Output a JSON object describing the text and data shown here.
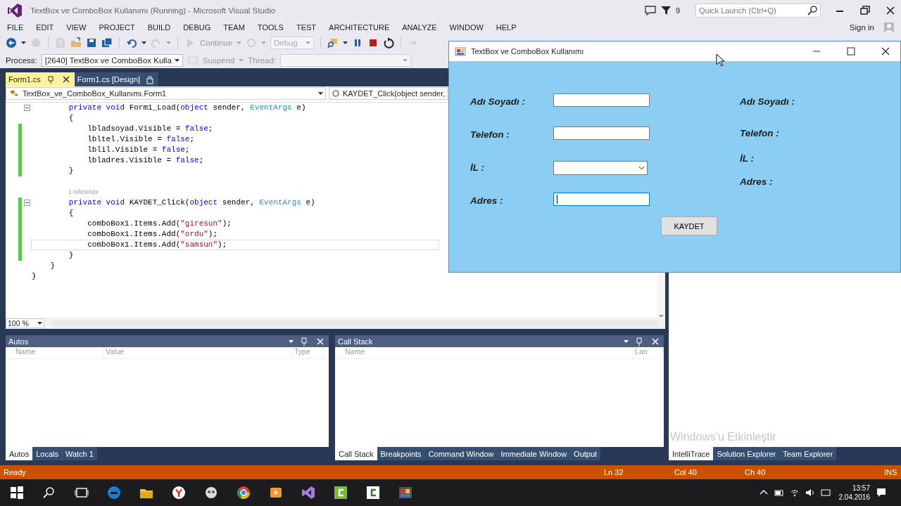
{
  "ide": {
    "title": "TextBox ve ComboBox Kullanımı (Running) - Microsoft Visual Studio",
    "notification_count": "9",
    "quick_launch": {
      "placeholder": "Quick Launch (Ctrl+Q)"
    },
    "menu": [
      "FILE",
      "EDIT",
      "VIEW",
      "PROJECT",
      "BUILD",
      "DEBUG",
      "TEAM",
      "TOOLS",
      "TEST",
      "ARCHITECTURE",
      "ANALYZE",
      "WINDOW",
      "HELP"
    ],
    "sign_in": "Sign in",
    "toolbar": {
      "continue": "Continue",
      "configuration": "Debug"
    },
    "debug_location": {
      "process_label": "Process:",
      "process": "[2640] TextBox ve ComboBox Kulla",
      "suspend": "Suspend",
      "thread_label": "Thread:"
    }
  },
  "editor": {
    "tabs": [
      {
        "label": "Form1.cs",
        "selected": true
      },
      {
        "label": "Form1.cs [Design]",
        "selected": false
      }
    ],
    "type_selector": "TextBox_ve_ComboBox_Kullanımı.Form1",
    "member_selector": "KAYDET_Click(object sender,",
    "lines": [
      {
        "kind": "code",
        "foldable": true,
        "changed": false,
        "current": false,
        "segments": [
          {
            "kind": "kw",
            "text": "        private void"
          },
          {
            "kind": "plain",
            "text": " Form1_Load("
          },
          {
            "kind": "kw",
            "text": "object"
          },
          {
            "kind": "plain",
            "text": " sender, "
          },
          {
            "kind": "type",
            "text": "EventArgs"
          },
          {
            "kind": "plain",
            "text": " e)"
          }
        ]
      },
      {
        "kind": "code",
        "foldable": false,
        "changed": false,
        "current": false,
        "segments": [
          {
            "kind": "plain",
            "text": "        {"
          }
        ]
      },
      {
        "kind": "code",
        "foldable": false,
        "changed": true,
        "current": false,
        "segments": [
          {
            "kind": "plain",
            "text": "            lbladsoyad.Visible = "
          },
          {
            "kind": "kw",
            "text": "false"
          },
          {
            "kind": "plain",
            "text": ";"
          }
        ]
      },
      {
        "kind": "code",
        "foldable": false,
        "changed": true,
        "current": false,
        "segments": [
          {
            "kind": "plain",
            "text": "            lbltel.Visible = "
          },
          {
            "kind": "kw",
            "text": "false"
          },
          {
            "kind": "plain",
            "text": ";"
          }
        ]
      },
      {
        "kind": "code",
        "foldable": false,
        "changed": true,
        "current": false,
        "segments": [
          {
            "kind": "plain",
            "text": "            lblil.Visible = "
          },
          {
            "kind": "kw",
            "text": "false"
          },
          {
            "kind": "plain",
            "text": ";"
          }
        ]
      },
      {
        "kind": "code",
        "foldable": false,
        "changed": true,
        "current": false,
        "segments": [
          {
            "kind": "plain",
            "text": "            lbladres.Visible = "
          },
          {
            "kind": "kw",
            "text": "false"
          },
          {
            "kind": "plain",
            "text": ";"
          }
        ]
      },
      {
        "kind": "code",
        "foldable": false,
        "changed": true,
        "current": false,
        "segments": [
          {
            "kind": "plain",
            "text": "        }"
          }
        ]
      },
      {
        "kind": "blank"
      },
      {
        "kind": "codelens",
        "text": "1 reference"
      },
      {
        "kind": "code",
        "foldable": true,
        "changed": true,
        "current": false,
        "segments": [
          {
            "kind": "kw",
            "text": "        private void"
          },
          {
            "kind": "plain",
            "text": " KAYDET_Click("
          },
          {
            "kind": "kw",
            "text": "object"
          },
          {
            "kind": "plain",
            "text": " sender, "
          },
          {
            "kind": "type",
            "text": "EventArgs"
          },
          {
            "kind": "plain",
            "text": " e)"
          }
        ]
      },
      {
        "kind": "code",
        "foldable": false,
        "changed": true,
        "current": false,
        "segments": [
          {
            "kind": "plain",
            "text": "        {"
          }
        ]
      },
      {
        "kind": "code",
        "foldable": false,
        "changed": true,
        "current": false,
        "segments": [
          {
            "kind": "plain",
            "text": "            comboBox1.Items.Add("
          },
          {
            "kind": "str",
            "text": "\"giresun\""
          },
          {
            "kind": "plain",
            "text": ");"
          }
        ]
      },
      {
        "kind": "code",
        "foldable": false,
        "changed": true,
        "current": false,
        "segments": [
          {
            "kind": "plain",
            "text": "            comboBox1.Items.Add("
          },
          {
            "kind": "str",
            "text": "\"ordu\""
          },
          {
            "kind": "plain",
            "text": ");"
          }
        ]
      },
      {
        "kind": "code",
        "foldable": false,
        "changed": true,
        "current": true,
        "segments": [
          {
            "kind": "plain",
            "text": "            comboBox1.Items.Add("
          },
          {
            "kind": "str",
            "text": "\"samsun\""
          },
          {
            "kind": "plain",
            "text": ");"
          }
        ]
      },
      {
        "kind": "code",
        "foldable": false,
        "changed": true,
        "current": false,
        "segments": [
          {
            "kind": "plain",
            "text": "        }"
          }
        ]
      },
      {
        "kind": "code",
        "foldable": false,
        "changed": false,
        "current": false,
        "segments": [
          {
            "kind": "plain",
            "text": "    }"
          }
        ]
      },
      {
        "kind": "code",
        "foldable": false,
        "changed": false,
        "current": false,
        "segments": [
          {
            "kind": "plain",
            "text": "}"
          }
        ]
      }
    ],
    "zoom": "100 %"
  },
  "panels": [
    {
      "title": "Autos",
      "columns": [
        "Name",
        "Value",
        "Type"
      ],
      "tabs": [
        {
          "label": "Autos",
          "selected": true
        },
        {
          "label": "Locals",
          "selected": false
        },
        {
          "label": "Watch 1",
          "selected": false
        }
      ]
    },
    {
      "title": "Call Stack",
      "columns": [
        "Name",
        "Lan"
      ],
      "tabs": [
        {
          "label": "Call Stack",
          "selected": true
        },
        {
          "label": "Breakpoints",
          "selected": false
        },
        {
          "label": "Command Window",
          "selected": false
        },
        {
          "label": "Immediate Window",
          "selected": false
        },
        {
          "label": "Output",
          "selected": false
        }
      ]
    }
  ],
  "side_panel": {
    "tabs": [
      {
        "label": "IntelliTrace",
        "selected": true
      },
      {
        "label": "Solution Explorer",
        "selected": false
      },
      {
        "label": "Team Explorer",
        "selected": false
      }
    ]
  },
  "activation_notice": "Windows'u Etkinleştir",
  "status_bar": {
    "state": "Ready",
    "line": "Ln 32",
    "column": "Col 40",
    "char": "Ch 40",
    "mode": "INS"
  },
  "form_window": {
    "title": "TextBox ve ComboBox Kullanımı",
    "fields": [
      {
        "kind": "text",
        "label": "Adı Soyadı :",
        "focused": false
      },
      {
        "kind": "text",
        "label": "Telefon :",
        "focused": false
      },
      {
        "kind": "combo",
        "label": "İL :",
        "focused": false
      },
      {
        "kind": "text",
        "label": "Adres :",
        "focused": true
      }
    ],
    "button": "KAYDET",
    "output_labels": [
      "Adı Soyadı :",
      "Telefon :",
      "İL :",
      "Adres :"
    ]
  },
  "taskbar": {
    "time": "13:57",
    "date": "2.04.2016"
  }
}
